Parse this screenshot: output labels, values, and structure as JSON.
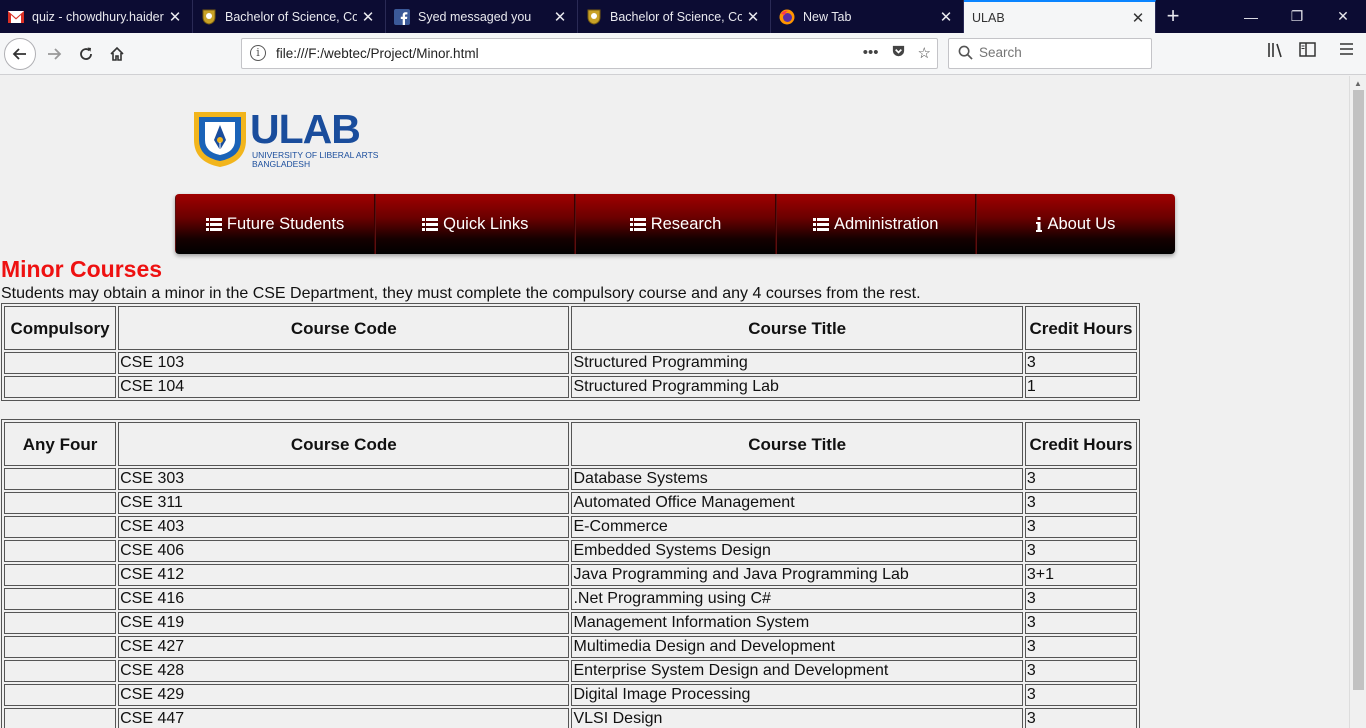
{
  "browser": {
    "tabs": [
      {
        "title": "quiz - chowdhury.haider",
        "icon": "gmail-icon",
        "active": false
      },
      {
        "title": "Bachelor of Science, Com",
        "icon": "ulab-favicon",
        "active": false
      },
      {
        "title": "Syed messaged you",
        "icon": "facebook-icon",
        "active": false
      },
      {
        "title": "Bachelor of Science, Com",
        "icon": "ulab-favicon",
        "active": false
      },
      {
        "title": "New Tab",
        "icon": "firefox-icon",
        "active": false
      },
      {
        "title": "ULAB",
        "icon": "",
        "active": true
      }
    ],
    "url": "file:///F:/webtec/Project/Minor.html",
    "search_placeholder": "Search"
  },
  "site": {
    "logo_text": "ULAB",
    "logo_sub1": "UNIVERSITY OF LIBERAL ARTS",
    "logo_sub2": "BANGLADESH",
    "menu": [
      {
        "label": "Future Students",
        "icon": "list-icon"
      },
      {
        "label": "Quick Links",
        "icon": "list-icon"
      },
      {
        "label": "Research",
        "icon": "list-icon"
      },
      {
        "label": "Administration",
        "icon": "list-icon"
      },
      {
        "label": "About Us",
        "icon": "info-icon"
      }
    ]
  },
  "content": {
    "title": "Minor Courses",
    "intro": "Students may obtain a minor in the CSE Department, they must complete the compulsory course and any 4 courses from the rest.",
    "compulsory_table": {
      "headers": [
        "Compulsory",
        "Course Code",
        "Course Title",
        "Credit Hours"
      ],
      "rows": [
        [
          "",
          "CSE 103",
          "Structured Programming",
          "3"
        ],
        [
          "",
          "CSE 104",
          "Structured Programming Lab",
          "1"
        ]
      ]
    },
    "elective_table": {
      "headers": [
        "Any Four",
        "Course Code",
        "Course Title",
        "Credit Hours"
      ],
      "rows": [
        [
          "",
          "CSE 303",
          "Database Systems",
          "3"
        ],
        [
          "",
          "CSE 311",
          "Automated Office Management",
          "3"
        ],
        [
          "",
          "CSE 403",
          "E-Commerce",
          "3"
        ],
        [
          "",
          "CSE 406",
          "Embedded Systems Design",
          "3"
        ],
        [
          "",
          "CSE 412",
          "Java Programming and Java Programming Lab",
          "3+1"
        ],
        [
          "",
          "CSE 416",
          ".Net Programming using C#",
          "3"
        ],
        [
          "",
          "CSE 419",
          "Management Information System",
          "3"
        ],
        [
          "",
          "CSE 427",
          "Multimedia Design and Development",
          "3"
        ],
        [
          "",
          "CSE 428",
          "Enterprise System Design and Development",
          "3"
        ],
        [
          "",
          "CSE 429",
          "Digital Image Processing",
          "3"
        ],
        [
          "",
          "CSE 447",
          "VLSI Design",
          "3"
        ]
      ]
    }
  },
  "colors": {
    "title_red": "#ee1111",
    "menu_dark_red": "#8b0000",
    "logo_blue": "#1a4d9c",
    "logo_yellow": "#f2b51c"
  }
}
